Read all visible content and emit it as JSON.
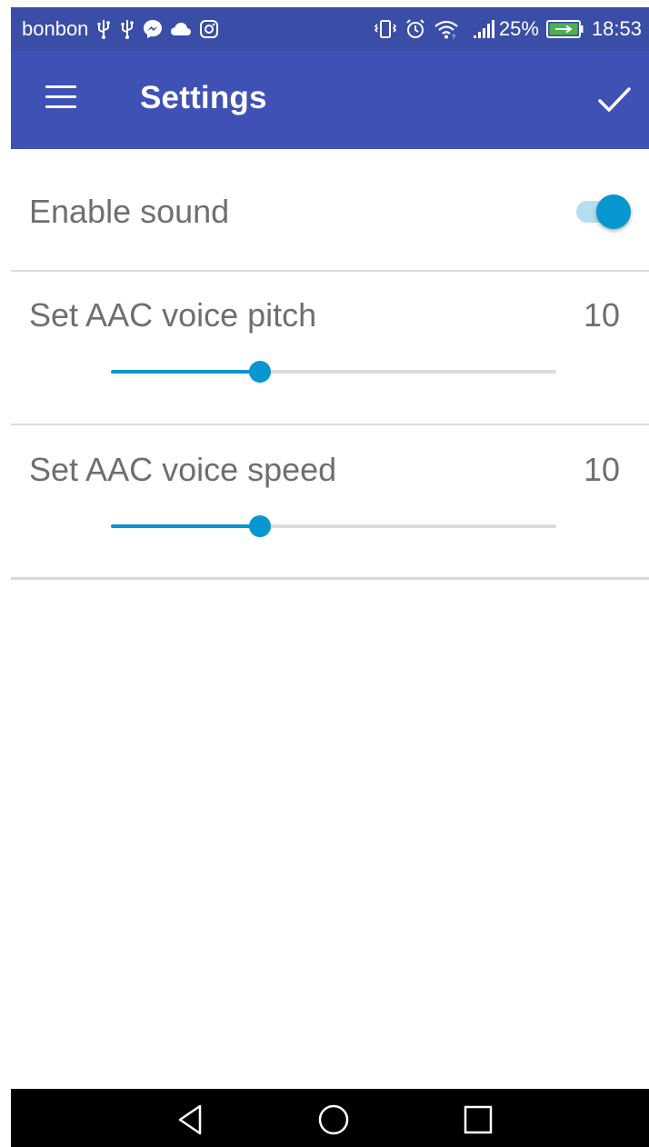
{
  "status_bar": {
    "carrier": "bonbon",
    "battery_percent": "25%",
    "time": "18:53",
    "left_icons": [
      "usb-icon",
      "usb-icon",
      "messenger-icon",
      "cloud-icon",
      "instagram-icon"
    ],
    "right_icons": [
      "vibrate-icon",
      "alarm-icon",
      "wifi-icon",
      "signal-icon",
      "battery-charging-icon"
    ]
  },
  "app_bar": {
    "title": "Settings",
    "menu_icon": "menu-icon",
    "confirm_icon": "checkmark-icon",
    "background": "#3f51b5"
  },
  "settings": {
    "sound": {
      "label": "Enable sound",
      "enabled": true
    },
    "pitch": {
      "label": "Set AAC voice pitch",
      "value": "10",
      "fraction": 0.335
    },
    "speed": {
      "label": "Set AAC voice speed",
      "value": "10",
      "fraction": 0.335
    }
  },
  "colors": {
    "accent": "#0796cf",
    "status_bar": "#3a4ea8",
    "text": "#6f6f6f"
  },
  "nav_bar": {
    "buttons": [
      "back-icon",
      "home-icon",
      "recents-icon"
    ]
  }
}
